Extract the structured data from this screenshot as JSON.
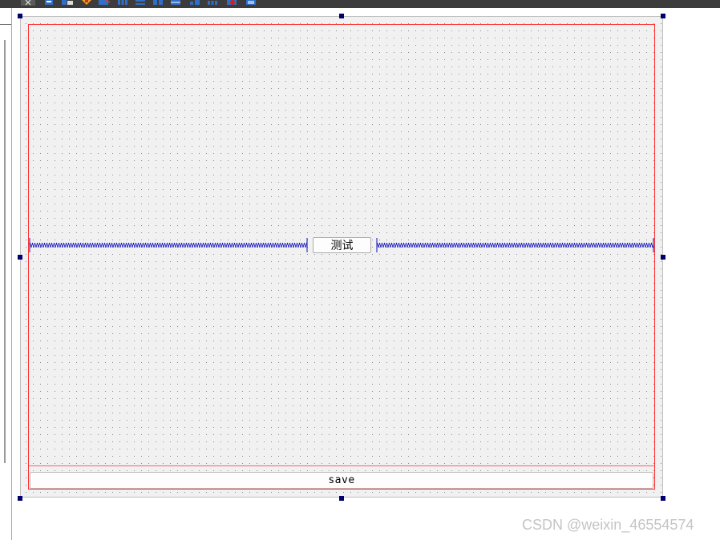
{
  "toolbar": {
    "icons": [
      "close-icon",
      "widget-editing-icon",
      "signal-slot-icon",
      "buddy-icon",
      "tab-order-icon",
      "horizontal-layout-icon",
      "vertical-layout-icon",
      "horizontal-splitter-icon",
      "vertical-splitter-icon",
      "form-layout-icon",
      "grid-layout-icon",
      "break-layout-icon",
      "adjust-size-icon"
    ]
  },
  "form": {
    "test_button_label": "测试",
    "save_button_label": "save"
  },
  "watermark": "CSDN @weixin_46554574",
  "colors": {
    "layout_border": "#ff3030",
    "selection_handle": "#00006e",
    "spacer": "#1010c0",
    "form_background": "#f1f1f1"
  }
}
